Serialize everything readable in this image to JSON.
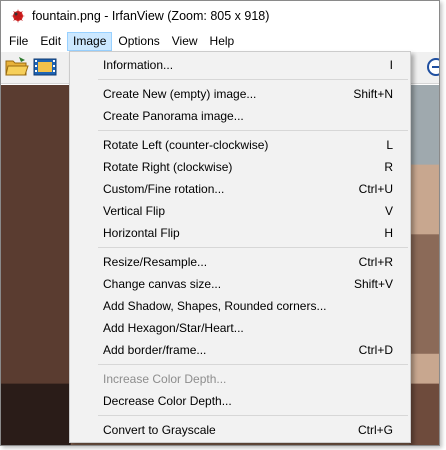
{
  "window": {
    "title": "fountain.png - IrfanView (Zoom: 805 x 918)"
  },
  "menubar": [
    {
      "label": "File"
    },
    {
      "label": "Edit"
    },
    {
      "label": "Image"
    },
    {
      "label": "Options"
    },
    {
      "label": "View"
    },
    {
      "label": "Help"
    }
  ],
  "image_menu": {
    "information": {
      "label": "Information...",
      "shortcut": "I"
    },
    "create_new": {
      "label": "Create New (empty) image...",
      "shortcut": "Shift+N"
    },
    "create_panorama": {
      "label": "Create Panorama image...",
      "shortcut": ""
    },
    "rotate_left": {
      "label": "Rotate Left (counter-clockwise)",
      "shortcut": "L"
    },
    "rotate_right": {
      "label": "Rotate Right (clockwise)",
      "shortcut": "R"
    },
    "custom_rotation": {
      "label": "Custom/Fine rotation...",
      "shortcut": "Ctrl+U"
    },
    "vertical_flip": {
      "label": "Vertical Flip",
      "shortcut": "V"
    },
    "horizontal_flip": {
      "label": "Horizontal Flip",
      "shortcut": "H"
    },
    "resize": {
      "label": "Resize/Resample...",
      "shortcut": "Ctrl+R"
    },
    "canvas_size": {
      "label": "Change canvas size...",
      "shortcut": "Shift+V"
    },
    "add_shadow": {
      "label": "Add Shadow, Shapes, Rounded corners...",
      "shortcut": ""
    },
    "add_hexagon": {
      "label": "Add Hexagon/Star/Heart...",
      "shortcut": ""
    },
    "add_border": {
      "label": "Add border/frame...",
      "shortcut": "Ctrl+D"
    },
    "increase_depth": {
      "label": "Increase Color Depth...",
      "shortcut": ""
    },
    "decrease_depth": {
      "label": "Decrease Color Depth...",
      "shortcut": ""
    },
    "grayscale": {
      "label": "Convert to Grayscale",
      "shortcut": "Ctrl+G"
    }
  },
  "colors": {
    "menu_bg": "#f2f2f2",
    "menu_active": "#cce8ff",
    "disabled_text": "#8d8d8d"
  },
  "icons": [
    "irfanview-app-icon",
    "open-folder-icon",
    "filmstrip-icon",
    "zoom-out-icon"
  ]
}
